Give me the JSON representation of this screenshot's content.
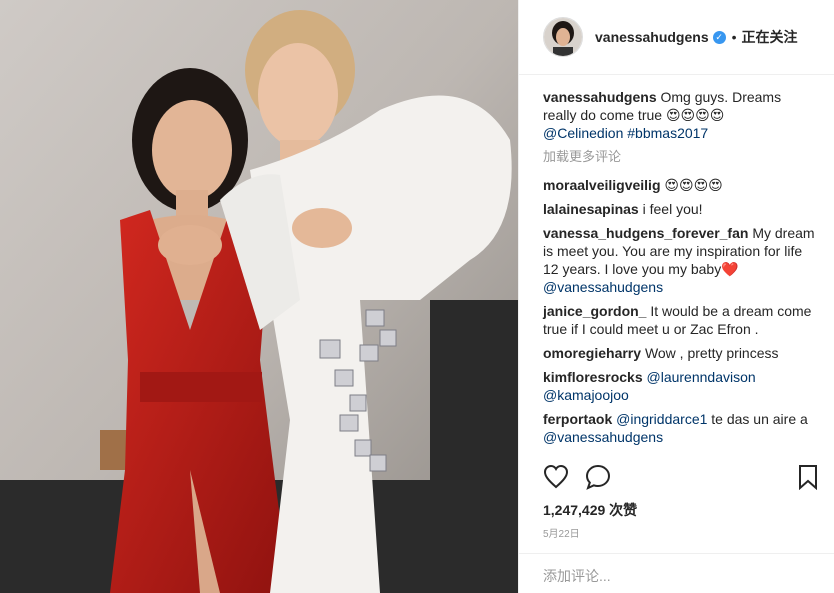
{
  "header": {
    "username": "vanessahudgens",
    "separator": "•",
    "follow_label": "正在关注"
  },
  "caption": {
    "username": "vanessahudgens",
    "text": "Omg guys. Dreams really do come true 😍😍😍😍",
    "mentions": "@Celinedion #bbmas2017"
  },
  "load_more": "加载更多评论",
  "comments": [
    {
      "user": "moraalveiligveilig",
      "text": "😍😍😍😍"
    },
    {
      "user": "lalainesapinas",
      "text": "i feel you!"
    },
    {
      "user": "vanessa_hudgens_forever_fan",
      "text": "My dream is meet you. You are my inspiration for life 12 years. I love you my baby❤️",
      "mention": "@vanessahudgens"
    },
    {
      "user": "janice_gordon_",
      "text": "It would be a dream come true if I could meet u or Zac Efron ."
    },
    {
      "user": "omoregieharry",
      "text": "Wow , pretty princess"
    },
    {
      "user": "kimfloresrocks",
      "mention1": "@laurenndavison",
      "mention2": "@kamajoojoo"
    },
    {
      "user": "ferportaok",
      "mention1": "@ingriddarce1",
      "text": "te das un aire a",
      "mention2": "@vanessahudgens"
    }
  ],
  "likes": "1,247,429 次赞",
  "date": "5月22日",
  "add_comment_placeholder": "添加评论...",
  "icons": {
    "like": "heart-outline-icon",
    "comment": "speech-bubble-icon",
    "save": "bookmark-icon",
    "verified": "verified-badge-icon"
  },
  "colors": {
    "link": "#003569",
    "verified": "#3897f0",
    "muted": "#999999"
  }
}
